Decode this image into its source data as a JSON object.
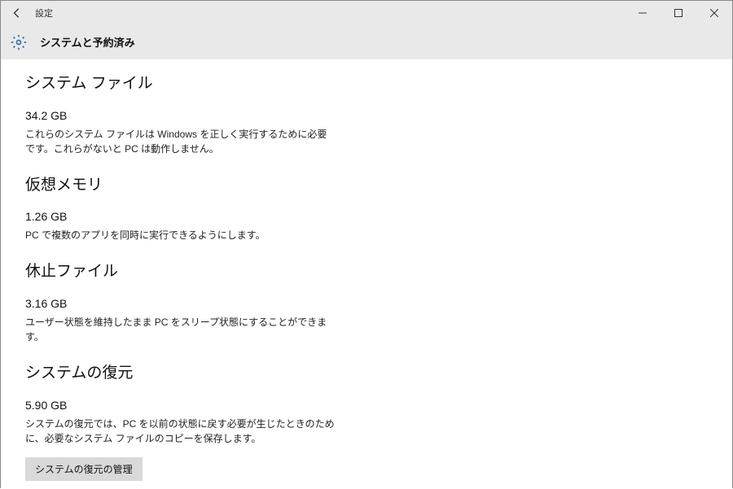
{
  "window": {
    "title": "設定"
  },
  "header": {
    "page_title": "システムと予約済み"
  },
  "sections": {
    "system_files": {
      "heading": "システム ファイル",
      "value": "34.2 GB",
      "desc": "これらのシステム ファイルは Windows を正しく実行するために必要です。これらがないと PC は動作しません。"
    },
    "virtual_memory": {
      "heading": "仮想メモリ",
      "value": "1.26 GB",
      "desc": "PC で複数のアプリを同時に実行できるようにします。"
    },
    "hibernation": {
      "heading": "休止ファイル",
      "value": "3.16 GB",
      "desc": "ユーザー状態を維持したまま PC をスリープ状態にすることができます。"
    },
    "system_restore": {
      "heading": "システムの復元",
      "value": "5.90 GB",
      "desc": "システムの復元では、PC を以前の状態に戻す必要が生じたときのために、必要なシステム ファイルのコピーを保存します。",
      "button": "システムの復元の管理"
    }
  }
}
